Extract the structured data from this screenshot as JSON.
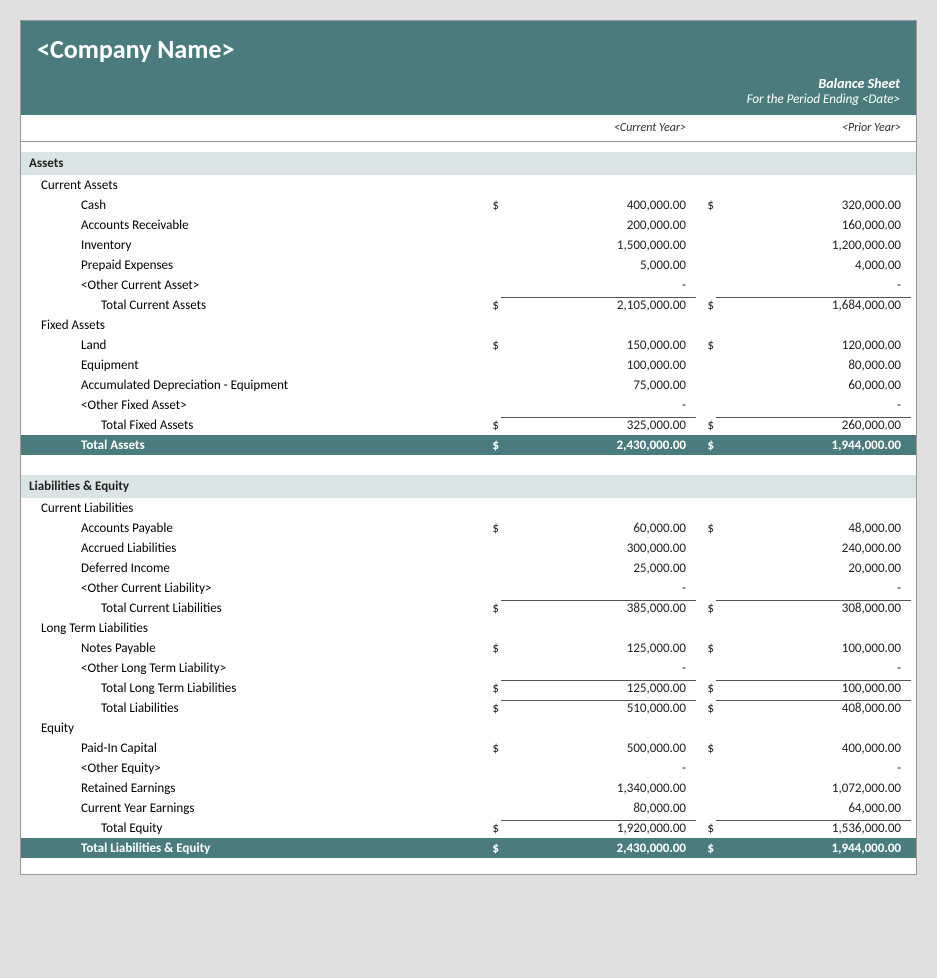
{
  "header": {
    "company_name": "<Company Name>",
    "sheet_title": "Balance Sheet",
    "sheet_subtitle": "For the Period Ending <Date>",
    "col_current": "<Current Year>",
    "col_prior": "<Prior Year>"
  },
  "assets": {
    "section_label": "Assets",
    "current_assets": {
      "group_label": "Current Assets",
      "items": [
        {
          "label": "Cash",
          "dollar": "$",
          "cy": "400,000.00",
          "py_dollar": "$",
          "py": "320,000.00"
        },
        {
          "label": "Accounts Receivable",
          "dollar": "",
          "cy": "200,000.00",
          "py_dollar": "",
          "py": "160,000.00"
        },
        {
          "label": "Inventory",
          "dollar": "",
          "cy": "1,500,000.00",
          "py_dollar": "",
          "py": "1,200,000.00"
        },
        {
          "label": "Prepaid Expenses",
          "dollar": "",
          "cy": "5,000.00",
          "py_dollar": "",
          "py": "4,000.00"
        },
        {
          "label": "<Other Current Asset>",
          "dollar": "",
          "cy": "-",
          "py_dollar": "",
          "py": "-"
        }
      ],
      "total_label": "Total Current Assets",
      "total_dollar": "$",
      "total_cy": "2,105,000.00",
      "total_py_dollar": "$",
      "total_py": "1,684,000.00"
    },
    "fixed_assets": {
      "group_label": "Fixed Assets",
      "items": [
        {
          "label": "Land",
          "dollar": "$",
          "cy": "150,000.00",
          "py_dollar": "$",
          "py": "120,000.00"
        },
        {
          "label": "Equipment",
          "dollar": "",
          "cy": "100,000.00",
          "py_dollar": "",
          "py": "80,000.00"
        },
        {
          "label": "Accumulated Depreciation - Equipment",
          "dollar": "",
          "cy": "75,000.00",
          "py_dollar": "",
          "py": "60,000.00"
        },
        {
          "label": "<Other Fixed Asset>",
          "dollar": "",
          "cy": "-",
          "py_dollar": "",
          "py": "-"
        }
      ],
      "total_label": "Total Fixed Assets",
      "total_dollar": "$",
      "total_cy": "325,000.00",
      "total_py_dollar": "$",
      "total_py": "260,000.00"
    },
    "grand_total_label": "Total Assets",
    "grand_total_dollar": "$",
    "grand_total_cy": "2,430,000.00",
    "grand_total_py_dollar": "$",
    "grand_total_py": "1,944,000.00"
  },
  "liabilities": {
    "section_label": "Liabilities & Equity",
    "current_liabilities": {
      "group_label": "Current Liabilities",
      "items": [
        {
          "label": "Accounts Payable",
          "dollar": "$",
          "cy": "60,000.00",
          "py_dollar": "$",
          "py": "48,000.00"
        },
        {
          "label": "Accrued Liabilities",
          "dollar": "",
          "cy": "300,000.00",
          "py_dollar": "",
          "py": "240,000.00"
        },
        {
          "label": "Deferred Income",
          "dollar": "",
          "cy": "25,000.00",
          "py_dollar": "",
          "py": "20,000.00"
        },
        {
          "label": "<Other Current Liability>",
          "dollar": "",
          "cy": "-",
          "py_dollar": "",
          "py": "-"
        }
      ],
      "total_label": "Total Current Liabilities",
      "total_dollar": "$",
      "total_cy": "385,000.00",
      "total_py_dollar": "$",
      "total_py": "308,000.00"
    },
    "long_term_liabilities": {
      "group_label": "Long Term Liabilities",
      "items": [
        {
          "label": "Notes Payable",
          "dollar": "$",
          "cy": "125,000.00",
          "py_dollar": "$",
          "py": "100,000.00"
        },
        {
          "label": "<Other Long Term Liability>",
          "dollar": "",
          "cy": "-",
          "py_dollar": "",
          "py": "-"
        }
      ],
      "subtotal_label": "Total Long Term Liabilities",
      "subtotal_dollar": "$",
      "subtotal_cy": "125,000.00",
      "subtotal_py_dollar": "$",
      "subtotal_py": "100,000.00",
      "total_label": "Total Liabilities",
      "total_dollar": "$",
      "total_cy": "510,000.00",
      "total_py_dollar": "$",
      "total_py": "408,000.00"
    },
    "equity": {
      "group_label": "Equity",
      "items": [
        {
          "label": "Paid-In Capital",
          "dollar": "$",
          "cy": "500,000.00",
          "py_dollar": "$",
          "py": "400,000.00"
        },
        {
          "label": "<Other Equity>",
          "dollar": "",
          "cy": "-",
          "py_dollar": "",
          "py": "-"
        },
        {
          "label": "Retained Earnings",
          "dollar": "",
          "cy": "1,340,000.00",
          "py_dollar": "",
          "py": "1,072,000.00"
        },
        {
          "label": "Current Year Earnings",
          "dollar": "",
          "cy": "80,000.00",
          "py_dollar": "",
          "py": "64,000.00"
        }
      ],
      "total_label": "Total Equity",
      "total_dollar": "$",
      "total_cy": "1,920,000.00",
      "total_py_dollar": "$",
      "total_py": "1,536,000.00"
    },
    "grand_total_label": "Total Liabilities & Equity",
    "grand_total_dollar": "$",
    "grand_total_cy": "2,430,000.00",
    "grand_total_py_dollar": "$",
    "grand_total_py": "1,944,000.00"
  }
}
